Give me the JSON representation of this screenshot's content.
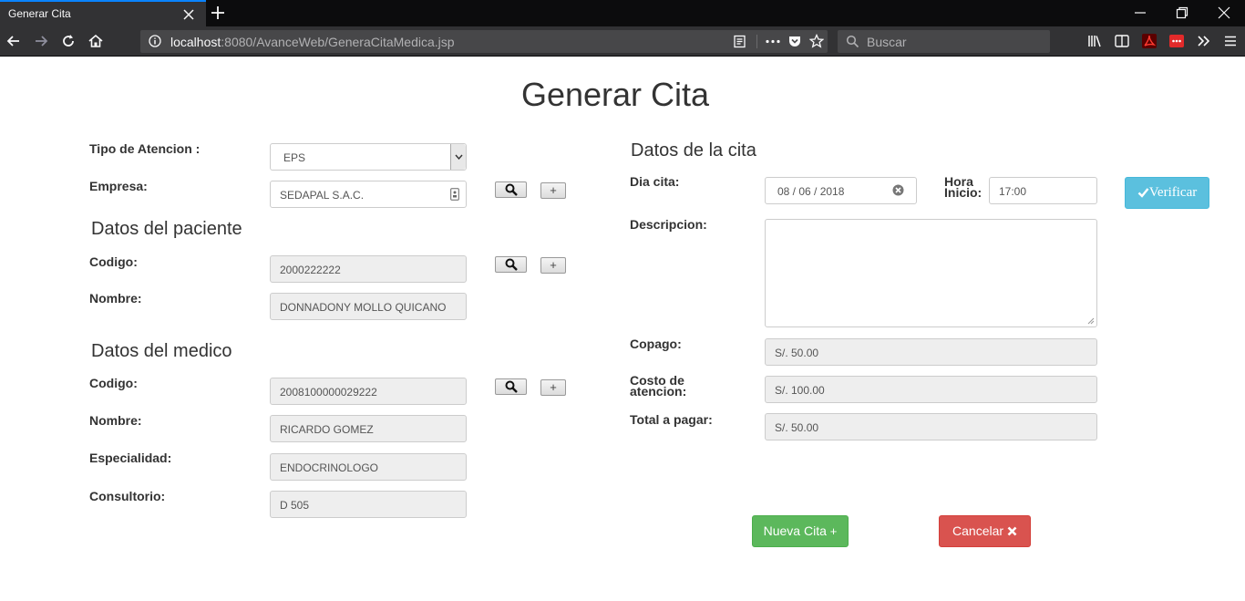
{
  "browser": {
    "tab_title": "Generar Cita",
    "url_host": "localhost",
    "url_rest": ":8080/AvanceWeb/GeneraCitaMedica.jsp",
    "search_placeholder": "Buscar"
  },
  "page": {
    "title": "Generar Cita"
  },
  "form_left": {
    "tipo_label": "Tipo de Atencion :",
    "tipo_value": "EPS",
    "empresa_label": "Empresa:",
    "empresa_value": "SEDAPAL S.A.C.",
    "plus_symbol": "+"
  },
  "paciente": {
    "heading": "Datos del paciente",
    "codigo_label": "Codigo:",
    "codigo_value": "2000222222",
    "nombre_label": "Nombre:",
    "nombre_value": "DONNADONY MOLLO QUICANO"
  },
  "medico": {
    "heading": "Datos del medico",
    "codigo_label": "Codigo:",
    "codigo_value": "2008100000029222",
    "nombre_label": "Nombre:",
    "nombre_value": "RICARDO GOMEZ",
    "especialidad_label": "Especialidad:",
    "especialidad_value": "ENDOCRINOLOGO",
    "consultorio_label": "Consultorio:",
    "consultorio_value": "D 505"
  },
  "cita": {
    "heading": "Datos de la cita",
    "dia_label": "Dia cita:",
    "dia_value": "08 / 06 / 2018",
    "hora_label_1": "Hora",
    "hora_label_2": "Inicio:",
    "hora_value": "17:00",
    "verificar_label": "Verificar",
    "descripcion_label": "Descripcion:",
    "copago_label": "Copago:",
    "copago_value": "S/. 50.00",
    "costo_label_1": "Costo de",
    "costo_label_2": "atencion:",
    "costo_value": "S/. 100.00",
    "total_label": "Total a pagar:",
    "total_value": "S/. 50.00"
  },
  "actions": {
    "nueva_label": "Nueva Cita",
    "nueva_symbol": "+",
    "cancelar_label": "Cancelar"
  },
  "colors": {
    "primary_info": "#5bc0de",
    "success": "#5cb85c",
    "danger": "#d9534f",
    "tab_accent": "#0a84ff"
  }
}
